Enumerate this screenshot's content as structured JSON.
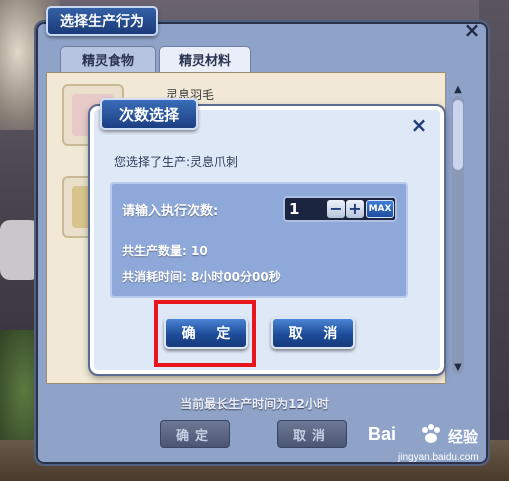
{
  "window": {
    "title": "选择生产行为",
    "close_icon": "×",
    "tabs": [
      {
        "label": "精灵食物",
        "active": false
      },
      {
        "label": "精灵材料",
        "active": true
      }
    ],
    "item_row_label": "灵息羽毛",
    "footer_text": "当前最长生产时间为12小时",
    "ok_label": "确定",
    "cancel_label": "取消"
  },
  "dialog": {
    "title": "次数选择",
    "close_icon": "×",
    "selected_text": "您选择了生产:灵息爪刺",
    "input_label": "请输入执行次数:",
    "count_value": "1",
    "minus_label": "−",
    "plus_label": "+",
    "max_label": "MAX",
    "total_quantity": "共生产数量: 10",
    "total_time": "共消耗时间: 8小时00分00秒",
    "ok_label": "确 定",
    "cancel_label": "取 消"
  },
  "watermark": {
    "brand": "Bai",
    "brand_cn": "经验",
    "url": "jingyan.baidu.com"
  },
  "colors": {
    "highlight": "#e8161c",
    "title_blue": "#1c3f82",
    "panel_blue": "#8ea9d9"
  }
}
